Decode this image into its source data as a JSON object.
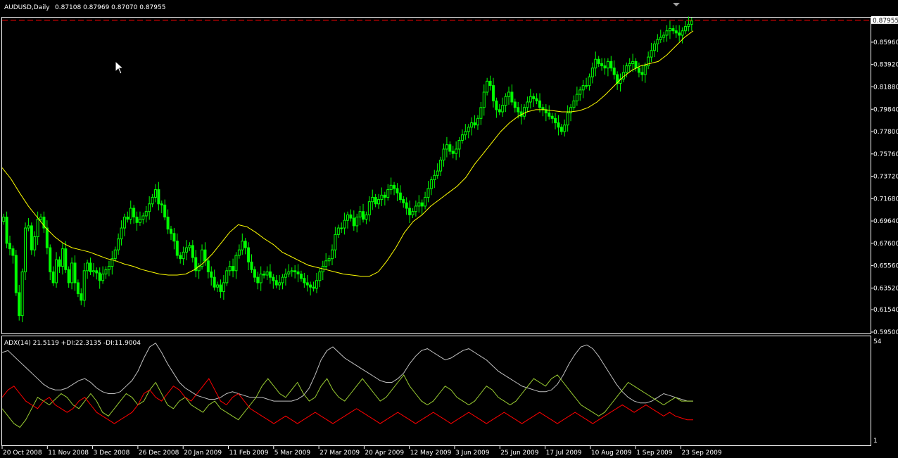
{
  "window": {
    "symbol_info": "AUDUSD,Daily",
    "ohlc_readout": "0.87108 0.87969 0.87070 0.87955"
  },
  "colors": {
    "background": "#000000",
    "frame": "#ffffff",
    "bull_candle": "#00ff00",
    "bear_candle": "#00ff00",
    "moving_average": "#ffff00",
    "price_line": "#ff0000",
    "current_price_tag": "#ffffff",
    "adx_line": "#c0c0c0",
    "plus_di": "#9acd32",
    "minus_di": "#ff0000"
  },
  "chart_data": [
    {
      "type": "line",
      "pane": "price",
      "title": "AUDUSD,Daily",
      "x_tick_labels": [
        "20 Oct 2008",
        "11 Nov 2008",
        "3 Dec 2008",
        "26 Dec 2008",
        "20 Jan 2009",
        "11 Feb 2009",
        "5 Mar 2009",
        "27 Mar 2009",
        "20 Apr 2009",
        "12 May 2009",
        "3 Jun 2009",
        "25 Jun 2009",
        "17 Jul 2009",
        "10 Aug 2009",
        "1 Sep 2009",
        "23 Sep 2009"
      ],
      "y_tick_labels": [
        "0.85960",
        "0.83920",
        "0.81880",
        "0.79840",
        "0.77800",
        "0.75760",
        "0.73720",
        "0.71680",
        "0.69640",
        "0.67600",
        "0.65560",
        "0.63520",
        "0.61540",
        "0.59500"
      ],
      "ylim": [
        0.595,
        0.8814
      ],
      "current_price": "0.87955",
      "candle_close_series": [
        0.7,
        0.676,
        0.671,
        0.665,
        0.631,
        0.61,
        0.65,
        0.69,
        0.692,
        0.67,
        0.682,
        0.698,
        0.7,
        0.69,
        0.672,
        0.65,
        0.64,
        0.661,
        0.655,
        0.671,
        0.652,
        0.64,
        0.658,
        0.64,
        0.63,
        0.624,
        0.651,
        0.658,
        0.65,
        0.651,
        0.649,
        0.642,
        0.648,
        0.652,
        0.655,
        0.662,
        0.67,
        0.68,
        0.69,
        0.7,
        0.698,
        0.708,
        0.7,
        0.695,
        0.698,
        0.701,
        0.705,
        0.712,
        0.718,
        0.725,
        0.712,
        0.711,
        0.7,
        0.689,
        0.685,
        0.678,
        0.665,
        0.662,
        0.668,
        0.672,
        0.674,
        0.663,
        0.651,
        0.655,
        0.67,
        0.66,
        0.65,
        0.645,
        0.636,
        0.638,
        0.632,
        0.64,
        0.651,
        0.655,
        0.651,
        0.665,
        0.67,
        0.678,
        0.672,
        0.659,
        0.652,
        0.645,
        0.64,
        0.648,
        0.647,
        0.65,
        0.645,
        0.642,
        0.638,
        0.64,
        0.645,
        0.648,
        0.65,
        0.651,
        0.65,
        0.648,
        0.644,
        0.64,
        0.638,
        0.636,
        0.635,
        0.642,
        0.65,
        0.655,
        0.66,
        0.662,
        0.67,
        0.684,
        0.69,
        0.69,
        0.697,
        0.702,
        0.699,
        0.692,
        0.7,
        0.705,
        0.698,
        0.702,
        0.714,
        0.718,
        0.712,
        0.716,
        0.72,
        0.718,
        0.725,
        0.729,
        0.726,
        0.722,
        0.716,
        0.713,
        0.708,
        0.702,
        0.705,
        0.71,
        0.713,
        0.71,
        0.718,
        0.726,
        0.734,
        0.738,
        0.742,
        0.752,
        0.762,
        0.766,
        0.76,
        0.758,
        0.762,
        0.77,
        0.775,
        0.778,
        0.782,
        0.786,
        0.784,
        0.79,
        0.8,
        0.814,
        0.824,
        0.82,
        0.806,
        0.798,
        0.796,
        0.802,
        0.81,
        0.814,
        0.805,
        0.8,
        0.796,
        0.792,
        0.8,
        0.805,
        0.81,
        0.808,
        0.806,
        0.8,
        0.798,
        0.795,
        0.792,
        0.79,
        0.786,
        0.782,
        0.778,
        0.784,
        0.795,
        0.8,
        0.806,
        0.812,
        0.816,
        0.82,
        0.82,
        0.828,
        0.836,
        0.844,
        0.84,
        0.838,
        0.836,
        0.842,
        0.836,
        0.83,
        0.822,
        0.826,
        0.832,
        0.838,
        0.84,
        0.842,
        0.836,
        0.832,
        0.83,
        0.838,
        0.846,
        0.852,
        0.858,
        0.862,
        0.864,
        0.866,
        0.87,
        0.872,
        0.87,
        0.868,
        0.866,
        0.87,
        0.874,
        0.876,
        0.879
      ],
      "moving_average_series": [
        0.745,
        0.735,
        0.722,
        0.71,
        0.7,
        0.69,
        0.682,
        0.676,
        0.672,
        0.67,
        0.668,
        0.665,
        0.662,
        0.66,
        0.657,
        0.655,
        0.652,
        0.65,
        0.648,
        0.647,
        0.647,
        0.648,
        0.652,
        0.658,
        0.666,
        0.676,
        0.686,
        0.693,
        0.691,
        0.686,
        0.68,
        0.675,
        0.668,
        0.664,
        0.66,
        0.656,
        0.654,
        0.652,
        0.65,
        0.648,
        0.647,
        0.646,
        0.646,
        0.65,
        0.66,
        0.672,
        0.686,
        0.696,
        0.702,
        0.71,
        0.716,
        0.722,
        0.728,
        0.736,
        0.748,
        0.758,
        0.768,
        0.778,
        0.786,
        0.792,
        0.796,
        0.798,
        0.798,
        0.797,
        0.796,
        0.796,
        0.797,
        0.8,
        0.805,
        0.812,
        0.82,
        0.828,
        0.834,
        0.838,
        0.84,
        0.842,
        0.848,
        0.856,
        0.864,
        0.87
      ]
    },
    {
      "type": "line",
      "pane": "indicator",
      "title": "ADX(14) 21.5119 +DI:22.3135 -DI:11.9004",
      "y_tick_labels": [
        "54",
        "1"
      ],
      "ylim": [
        1,
        54
      ],
      "series": [
        {
          "name": "ADX(14) 21.5119",
          "values": [
            48,
            49,
            46,
            43,
            40,
            37,
            34,
            31,
            29,
            28,
            28,
            29,
            31,
            33,
            34,
            32,
            29,
            27,
            26,
            26,
            27,
            30,
            33,
            38,
            45,
            51,
            53,
            48,
            42,
            37,
            32,
            29,
            27,
            25,
            24,
            23,
            23,
            24,
            26,
            27,
            26,
            25,
            24,
            24,
            24,
            23,
            22,
            22,
            22,
            22,
            23,
            25,
            29,
            36,
            44,
            49,
            51,
            48,
            45,
            43,
            41,
            39,
            37,
            35,
            33,
            32,
            32,
            34,
            37,
            42,
            46,
            49,
            50,
            48,
            46,
            44,
            45,
            47,
            49,
            50,
            48,
            46,
            44,
            41,
            38,
            36,
            34,
            32,
            30,
            29,
            28,
            27,
            27,
            28,
            31,
            36,
            42,
            47,
            51,
            52,
            50,
            46,
            41,
            36,
            31,
            27,
            24,
            22,
            21,
            21,
            22,
            24,
            26,
            25,
            24,
            23,
            22,
            22
          ]
        },
        {
          "name": "+DI:22.3135",
          "values": [
            18,
            14,
            10,
            8,
            12,
            18,
            24,
            22,
            20,
            23,
            26,
            24,
            20,
            18,
            22,
            26,
            22,
            16,
            14,
            18,
            22,
            26,
            24,
            20,
            22,
            28,
            32,
            26,
            20,
            18,
            22,
            24,
            20,
            18,
            16,
            20,
            22,
            18,
            16,
            14,
            12,
            16,
            20,
            24,
            30,
            34,
            30,
            26,
            24,
            28,
            32,
            26,
            22,
            24,
            30,
            34,
            28,
            24,
            22,
            26,
            30,
            34,
            30,
            26,
            22,
            24,
            28,
            32,
            36,
            30,
            26,
            22,
            20,
            22,
            26,
            30,
            28,
            24,
            22,
            20,
            22,
            26,
            30,
            28,
            24,
            22,
            20,
            22,
            26,
            30,
            34,
            32,
            30,
            34,
            36,
            32,
            28,
            24,
            20,
            18,
            16,
            14,
            16,
            20,
            24,
            28,
            32,
            30,
            28,
            26,
            24,
            22,
            20,
            22,
            24,
            22,
            22,
            22
          ]
        },
        {
          "name": "-DI:11.9004",
          "values": [
            24,
            28,
            30,
            26,
            22,
            20,
            18,
            22,
            24,
            20,
            18,
            16,
            18,
            22,
            24,
            20,
            16,
            14,
            12,
            10,
            12,
            14,
            16,
            20,
            26,
            28,
            24,
            22,
            26,
            30,
            28,
            24,
            22,
            26,
            30,
            34,
            28,
            22,
            20,
            24,
            26,
            22,
            18,
            16,
            14,
            12,
            10,
            12,
            14,
            12,
            10,
            12,
            14,
            16,
            14,
            12,
            10,
            12,
            14,
            16,
            18,
            16,
            14,
            12,
            10,
            12,
            14,
            16,
            14,
            12,
            10,
            12,
            14,
            16,
            14,
            12,
            10,
            12,
            14,
            16,
            14,
            12,
            10,
            12,
            14,
            16,
            14,
            12,
            10,
            12,
            14,
            16,
            14,
            12,
            10,
            12,
            14,
            16,
            14,
            12,
            10,
            12,
            14,
            16,
            18,
            20,
            18,
            16,
            18,
            20,
            18,
            16,
            14,
            16,
            14,
            13,
            12,
            12
          ]
        }
      ]
    }
  ]
}
